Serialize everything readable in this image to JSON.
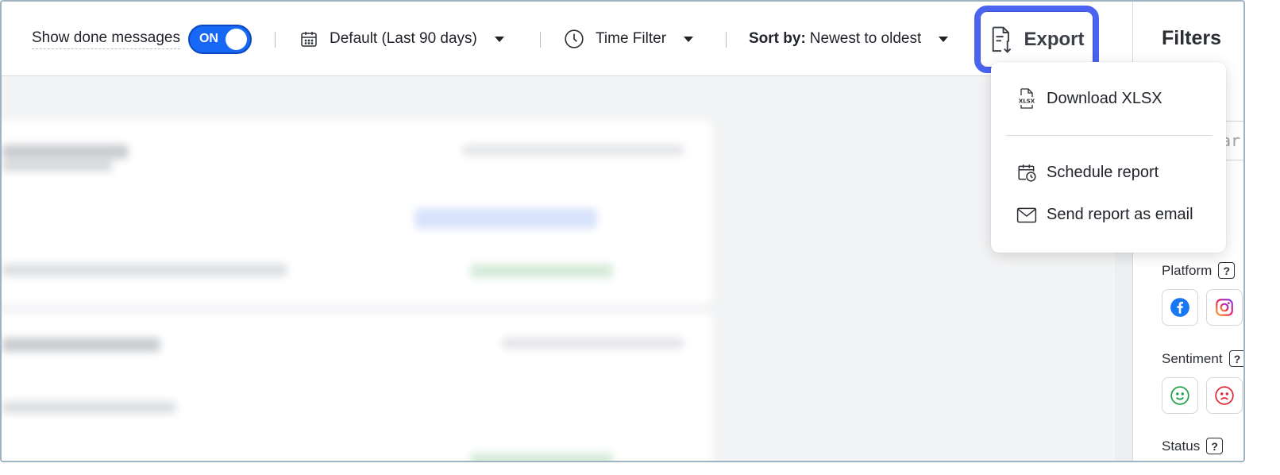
{
  "toolbar": {
    "show_done_label": "Show done messages",
    "toggle_state": "ON",
    "date_range_label": "Default (Last 90 days)",
    "time_filter_label": "Time Filter",
    "sort_prefix": "Sort by:",
    "sort_value": "Newest to oldest",
    "export_label": "Export"
  },
  "export_menu": {
    "items": [
      {
        "label": "Download XLSX",
        "icon": "xlsx-file-icon"
      },
      {
        "label": "Schedule report",
        "icon": "calendar-clock-icon"
      },
      {
        "label": "Send report as email",
        "icon": "envelope-icon"
      }
    ]
  },
  "filters": {
    "title": "Filters",
    "search_placeholder_fragment": "ar",
    "sections": [
      {
        "label": "Platform",
        "help": "?"
      },
      {
        "label": "Sentiment",
        "help": "?"
      },
      {
        "label": "Status",
        "help": "?"
      }
    ]
  },
  "colors": {
    "accent": "#1668f5",
    "export_highlight": "#4a63f0",
    "facebook": "#1877f2",
    "positive": "#22a34a",
    "negative": "#e0283a"
  }
}
